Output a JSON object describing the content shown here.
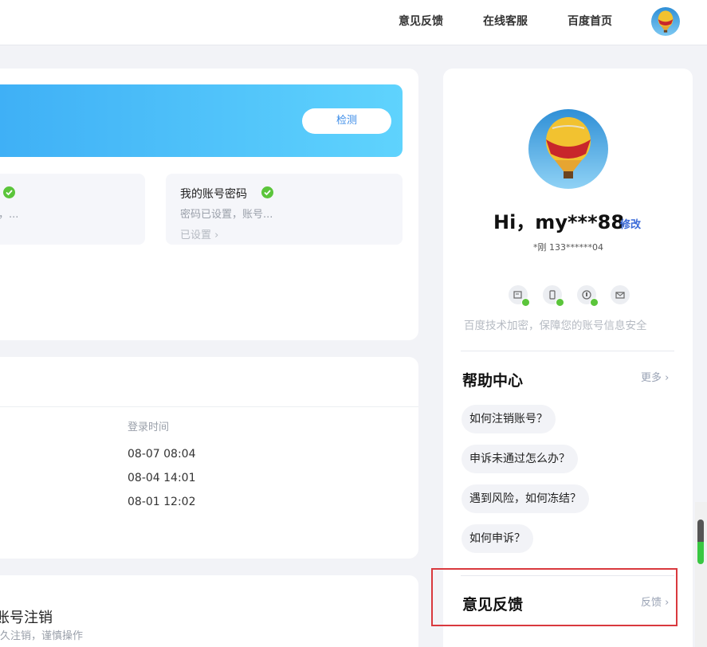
{
  "nav": {
    "feedback": "意见反馈",
    "online_service": "在线客服",
    "baidu_home": "百度首页"
  },
  "banner": {
    "detect_label": "检测"
  },
  "cards": [
    {
      "title": "",
      "desc": "，...",
      "status": ""
    },
    {
      "title": "我的账号密码",
      "desc": "密码已设置，账号...",
      "status": "已设置 ›"
    }
  ],
  "login": {
    "header": "登录时间",
    "times": [
      "08-07 08:04",
      "08-04 14:01",
      "08-01 12:02"
    ]
  },
  "cancel": {
    "title": "账号注销",
    "desc": "久注销，谨慎操作"
  },
  "profile": {
    "greeting": "Hi，my***88",
    "edit_label": "修改",
    "phone": "*刚  133******04",
    "security_icons": [
      "id-card-icon",
      "phone-icon",
      "lock-icon",
      "mail-icon"
    ],
    "security_note": "百度技术加密，保障您的账号信息安全"
  },
  "help": {
    "title": "帮助中心",
    "more_label": "更多 ›",
    "questions": [
      "如何注销账号？",
      "申诉未通过怎么办？",
      "遇到风险，如何冻结？",
      "如何申诉？"
    ]
  },
  "feedback": {
    "title": "意见反馈",
    "link_label": "反馈 ›"
  },
  "colors": {
    "accent": "#3a8be8",
    "success": "#5bc53b",
    "highlight": "#d9393e"
  }
}
